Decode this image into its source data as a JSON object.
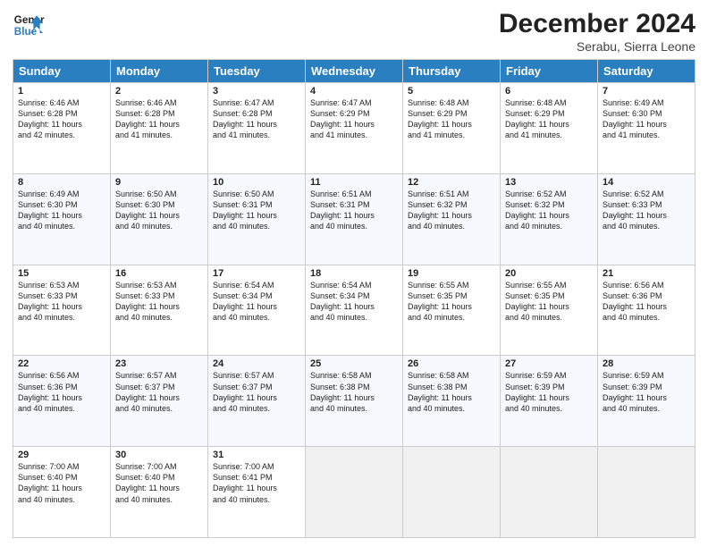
{
  "header": {
    "logo_line1": "General",
    "logo_line2": "Blue",
    "month_title": "December 2024",
    "location": "Serabu, Sierra Leone"
  },
  "weekdays": [
    "Sunday",
    "Monday",
    "Tuesday",
    "Wednesday",
    "Thursday",
    "Friday",
    "Saturday"
  ],
  "weeks": [
    [
      {
        "day": "1",
        "info": "Sunrise: 6:46 AM\nSunset: 6:28 PM\nDaylight: 11 hours\nand 42 minutes."
      },
      {
        "day": "2",
        "info": "Sunrise: 6:46 AM\nSunset: 6:28 PM\nDaylight: 11 hours\nand 41 minutes."
      },
      {
        "day": "3",
        "info": "Sunrise: 6:47 AM\nSunset: 6:28 PM\nDaylight: 11 hours\nand 41 minutes."
      },
      {
        "day": "4",
        "info": "Sunrise: 6:47 AM\nSunset: 6:29 PM\nDaylight: 11 hours\nand 41 minutes."
      },
      {
        "day": "5",
        "info": "Sunrise: 6:48 AM\nSunset: 6:29 PM\nDaylight: 11 hours\nand 41 minutes."
      },
      {
        "day": "6",
        "info": "Sunrise: 6:48 AM\nSunset: 6:29 PM\nDaylight: 11 hours\nand 41 minutes."
      },
      {
        "day": "7",
        "info": "Sunrise: 6:49 AM\nSunset: 6:30 PM\nDaylight: 11 hours\nand 41 minutes."
      }
    ],
    [
      {
        "day": "8",
        "info": "Sunrise: 6:49 AM\nSunset: 6:30 PM\nDaylight: 11 hours\nand 40 minutes."
      },
      {
        "day": "9",
        "info": "Sunrise: 6:50 AM\nSunset: 6:30 PM\nDaylight: 11 hours\nand 40 minutes."
      },
      {
        "day": "10",
        "info": "Sunrise: 6:50 AM\nSunset: 6:31 PM\nDaylight: 11 hours\nand 40 minutes."
      },
      {
        "day": "11",
        "info": "Sunrise: 6:51 AM\nSunset: 6:31 PM\nDaylight: 11 hours\nand 40 minutes."
      },
      {
        "day": "12",
        "info": "Sunrise: 6:51 AM\nSunset: 6:32 PM\nDaylight: 11 hours\nand 40 minutes."
      },
      {
        "day": "13",
        "info": "Sunrise: 6:52 AM\nSunset: 6:32 PM\nDaylight: 11 hours\nand 40 minutes."
      },
      {
        "day": "14",
        "info": "Sunrise: 6:52 AM\nSunset: 6:33 PM\nDaylight: 11 hours\nand 40 minutes."
      }
    ],
    [
      {
        "day": "15",
        "info": "Sunrise: 6:53 AM\nSunset: 6:33 PM\nDaylight: 11 hours\nand 40 minutes."
      },
      {
        "day": "16",
        "info": "Sunrise: 6:53 AM\nSunset: 6:33 PM\nDaylight: 11 hours\nand 40 minutes."
      },
      {
        "day": "17",
        "info": "Sunrise: 6:54 AM\nSunset: 6:34 PM\nDaylight: 11 hours\nand 40 minutes."
      },
      {
        "day": "18",
        "info": "Sunrise: 6:54 AM\nSunset: 6:34 PM\nDaylight: 11 hours\nand 40 minutes."
      },
      {
        "day": "19",
        "info": "Sunrise: 6:55 AM\nSunset: 6:35 PM\nDaylight: 11 hours\nand 40 minutes."
      },
      {
        "day": "20",
        "info": "Sunrise: 6:55 AM\nSunset: 6:35 PM\nDaylight: 11 hours\nand 40 minutes."
      },
      {
        "day": "21",
        "info": "Sunrise: 6:56 AM\nSunset: 6:36 PM\nDaylight: 11 hours\nand 40 minutes."
      }
    ],
    [
      {
        "day": "22",
        "info": "Sunrise: 6:56 AM\nSunset: 6:36 PM\nDaylight: 11 hours\nand 40 minutes."
      },
      {
        "day": "23",
        "info": "Sunrise: 6:57 AM\nSunset: 6:37 PM\nDaylight: 11 hours\nand 40 minutes."
      },
      {
        "day": "24",
        "info": "Sunrise: 6:57 AM\nSunset: 6:37 PM\nDaylight: 11 hours\nand 40 minutes."
      },
      {
        "day": "25",
        "info": "Sunrise: 6:58 AM\nSunset: 6:38 PM\nDaylight: 11 hours\nand 40 minutes."
      },
      {
        "day": "26",
        "info": "Sunrise: 6:58 AM\nSunset: 6:38 PM\nDaylight: 11 hours\nand 40 minutes."
      },
      {
        "day": "27",
        "info": "Sunrise: 6:59 AM\nSunset: 6:39 PM\nDaylight: 11 hours\nand 40 minutes."
      },
      {
        "day": "28",
        "info": "Sunrise: 6:59 AM\nSunset: 6:39 PM\nDaylight: 11 hours\nand 40 minutes."
      }
    ],
    [
      {
        "day": "29",
        "info": "Sunrise: 7:00 AM\nSunset: 6:40 PM\nDaylight: 11 hours\nand 40 minutes."
      },
      {
        "day": "30",
        "info": "Sunrise: 7:00 AM\nSunset: 6:40 PM\nDaylight: 11 hours\nand 40 minutes."
      },
      {
        "day": "31",
        "info": "Sunrise: 7:00 AM\nSunset: 6:41 PM\nDaylight: 11 hours\nand 40 minutes."
      },
      {
        "day": "",
        "info": ""
      },
      {
        "day": "",
        "info": ""
      },
      {
        "day": "",
        "info": ""
      },
      {
        "day": "",
        "info": ""
      }
    ]
  ]
}
